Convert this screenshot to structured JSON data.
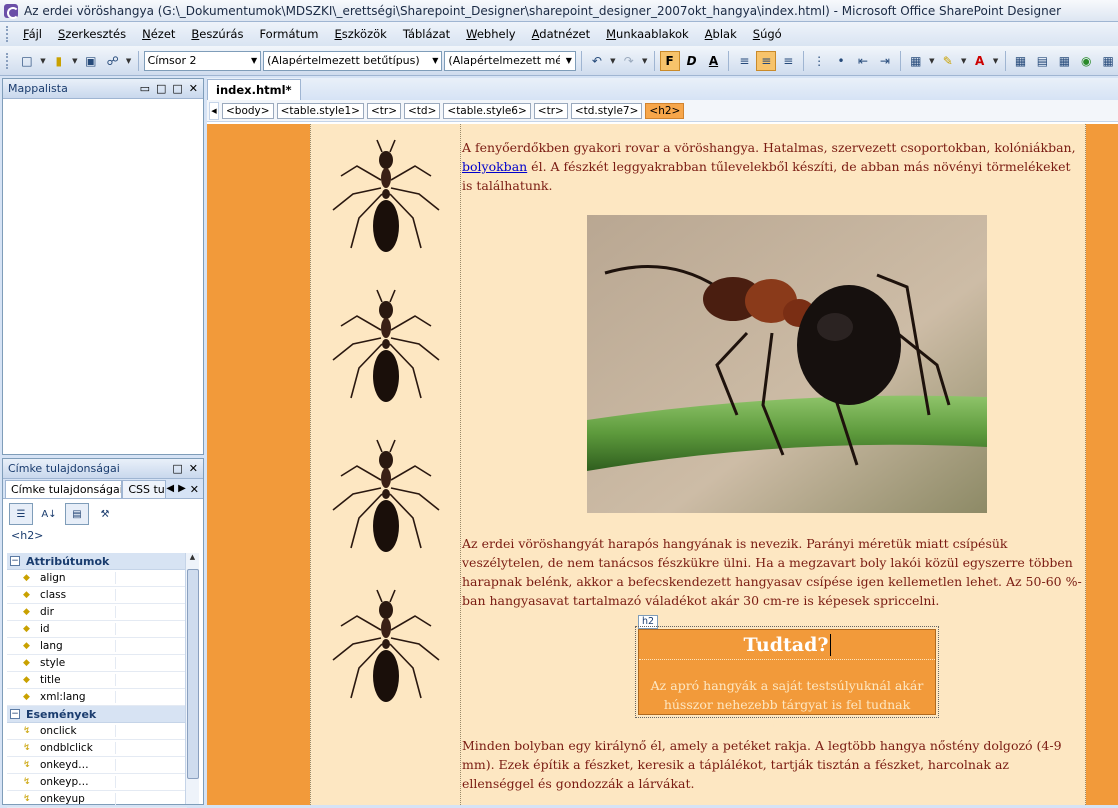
{
  "window": {
    "title": "Az erdei vöröshangya (G:\\_Dokumentumok\\MDSZKI\\_erettségi\\Sharepoint_Designer\\sharepoint_designer_2007okt_hangya\\index.html) - Microsoft Office SharePoint Designer"
  },
  "menu": [
    {
      "hot": "F",
      "rest": "ájl"
    },
    {
      "hot": "S",
      "rest": "zerkesztés"
    },
    {
      "hot": "N",
      "rest": "ézet"
    },
    {
      "hot": "B",
      "rest": "eszúrás"
    },
    {
      "hot": "",
      "rest": "Formátum"
    },
    {
      "hot": "E",
      "rest": "szközök"
    },
    {
      "hot": "",
      "rest": "Táblázat"
    },
    {
      "hot": "W",
      "rest": "ebhely"
    },
    {
      "hot": "A",
      "rest": "datnézet"
    },
    {
      "hot": "M",
      "rest": "unkaablakok"
    },
    {
      "hot": "A",
      "rest": "blak"
    },
    {
      "hot": "S",
      "rest": "úgó"
    }
  ],
  "toolbar": {
    "style_value": "Címsor 2",
    "font_value": "(Alapértelmezett betűtípus)",
    "size_value": "(Alapértelmezett méret)",
    "bold_label": "F",
    "italic_label": "D",
    "underline_label": "A"
  },
  "panels": {
    "folder_list_title": "Mappalista",
    "tag_props_title": "Címke tulajdonságai",
    "tab_tag": "Címke tulajdonságai",
    "tab_css": "CSS tula",
    "tag_name": "<h2>",
    "attributes_title": "Attribútumok",
    "attributes": [
      "align",
      "class",
      "dir",
      "id",
      "lang",
      "style",
      "title",
      "xml:lang"
    ],
    "events_title": "Események",
    "events": [
      "onclick",
      "ondblclick",
      "onkeyd…",
      "onkeyp…",
      "onkeyup"
    ]
  },
  "editor": {
    "doc_tab": "index.html*",
    "quick_tags": [
      "<body>",
      "<table.style1>",
      "<tr>",
      "<td>",
      "<table.style6>",
      "<tr>",
      "<td.style7>",
      "<h2>"
    ]
  },
  "content": {
    "p1_before": "A fenyőerdőkben gyakori rovar a vöröshangya. Hatalmas, szervezett csoportokban, kolóniákban, ",
    "p1_link": "bolyokban",
    "p1_after": " él. A fészkét leggyakrabban tűlevelekből készíti, de abban más növényi törmelékeket is találhatunk.",
    "p2": "Az erdei vöröshangyát harapós hangyának is nevezik. Parányi méretük miatt csípésük veszélytelen, de nem tanácsos fészkükre ülni. Ha a megzavart boly lakói közül egyszerre többen harapnak belénk, akkor a befecskendezett hangyasav csípése igen kellemetlen lehet. Az 50-60 %-ban hangyasavat tartalmazó váladékot akár 30 cm-re is képesek spriccelni.",
    "tip_badge": "h2",
    "tip_title": "Tudtad?",
    "tip_text": "Az apró hangyák a saját testsúlyuknál akár hússzor nehezebb tárgyat is fel tudnak emelni.",
    "p3": "Minden bolyban egy királynő él, amely a petéket rakja. A legtöbb hangya nőstény dolgozó (4-9 mm). Ezek építik a fészket, keresik a táplálékot, tartják tisztán a fészket, harcolnak az ellenséggel és gondozzák a lárvákat."
  }
}
